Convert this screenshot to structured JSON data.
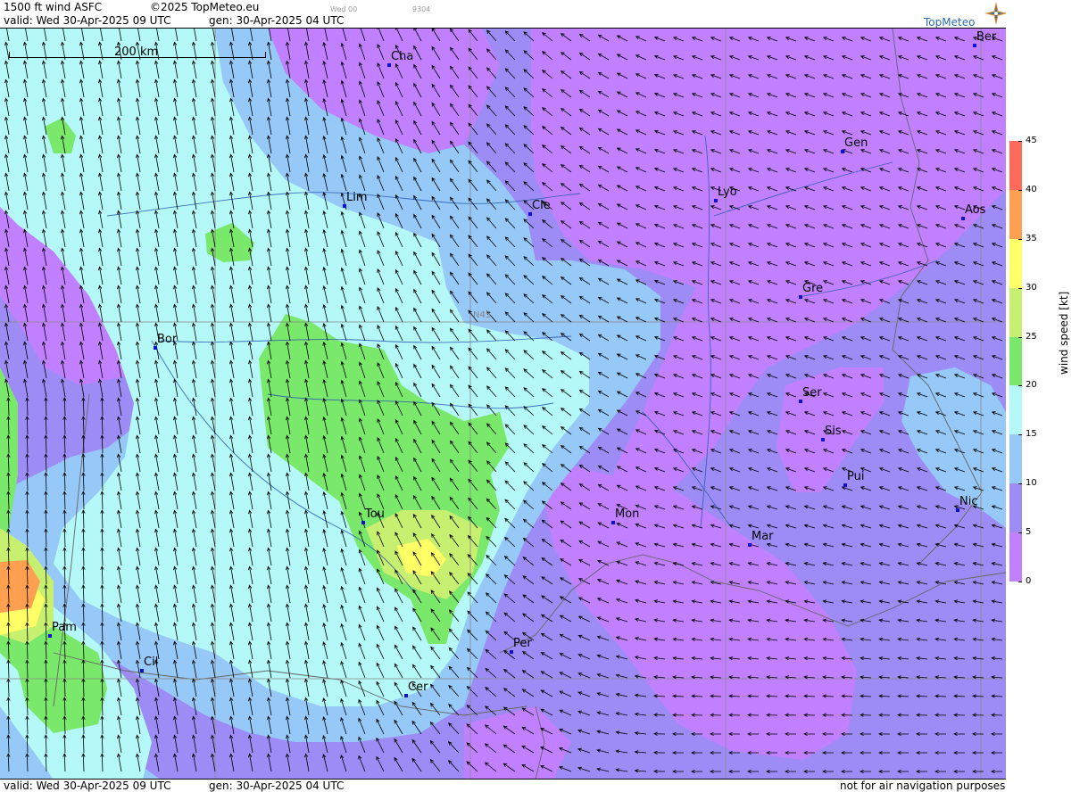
{
  "header": {
    "title": "1500 ft wind ASFC",
    "copyright": "©2025 TopMeteo.eu",
    "small_day": "Wed 00",
    "small_code": "9304",
    "valid": "valid:  Wed  30-Apr-2025  09 UTC",
    "gen": "gen: 30-Apr-2025 04 UTC"
  },
  "logo": {
    "text": "TopMeteo",
    "icon": "compass-star-icon"
  },
  "map": {
    "scale_label": "200 km",
    "lat_label": "N45",
    "cities": [
      {
        "name": "Cha"
      },
      {
        "name": "Ber"
      },
      {
        "name": "Gen"
      },
      {
        "name": "Lim"
      },
      {
        "name": "Cle"
      },
      {
        "name": "Lyo"
      },
      {
        "name": "Aos"
      },
      {
        "name": "Gre"
      },
      {
        "name": "Bor"
      },
      {
        "name": "Ser"
      },
      {
        "name": "Sis"
      },
      {
        "name": "Pui"
      },
      {
        "name": "Tou"
      },
      {
        "name": "Mon"
      },
      {
        "name": "Nic"
      },
      {
        "name": "Mar"
      },
      {
        "name": "Pam"
      },
      {
        "name": "Per"
      },
      {
        "name": "Cil"
      },
      {
        "name": "Cer"
      }
    ],
    "arrow_direction": "mostly from south-east, turning north in the west"
  },
  "legend": {
    "unit": "wind speed [kt]",
    "ticks": [
      "45",
      "40",
      "35",
      "30",
      "25",
      "20",
      "15",
      "10",
      "5",
      "0"
    ],
    "colors": [
      "#ff6a5a",
      "#ffa050",
      "#ffff66",
      "#c8f070",
      "#7ae86a",
      "#b4f8f8",
      "#96c8f8",
      "#9d8cf5",
      "#c080ff"
    ]
  },
  "footer": {
    "valid": "valid:  Wed  30-Apr-2025  09 UTC",
    "gen": "gen: 30-Apr-2025 04 UTC",
    "disclaimer": "not for air navigation purposes"
  }
}
